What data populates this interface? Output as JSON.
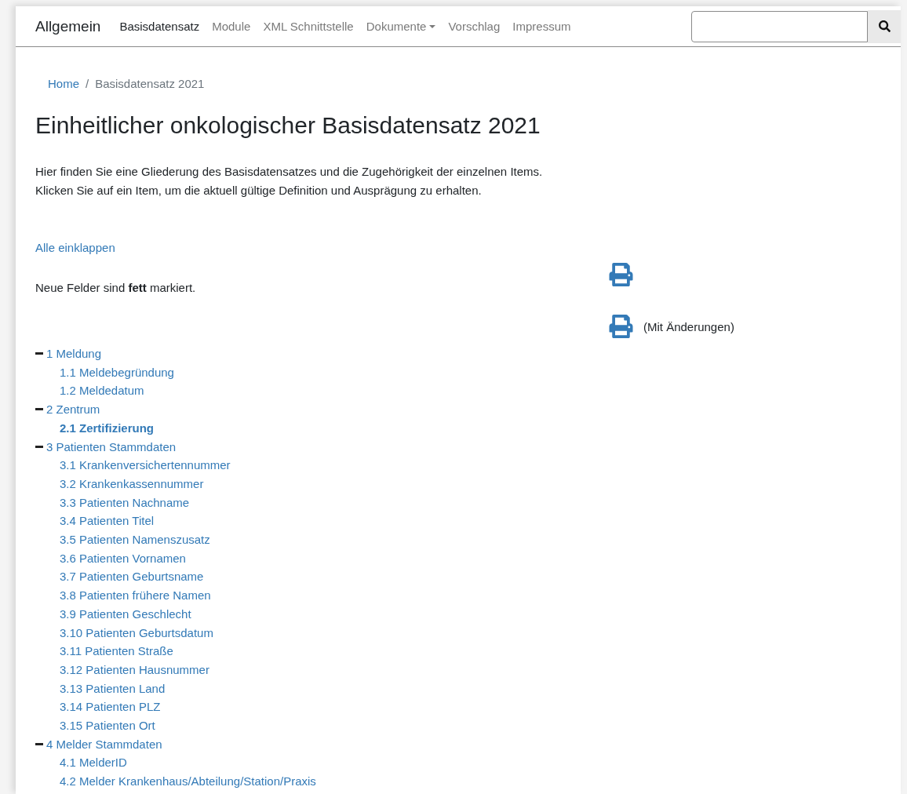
{
  "navbar": {
    "brand": "Allgemein",
    "items": [
      {
        "label": "Basisdatensatz",
        "selected": true,
        "dropdown": false
      },
      {
        "label": "Module",
        "selected": false,
        "dropdown": false
      },
      {
        "label": "XML Schnittstelle",
        "selected": false,
        "dropdown": false
      },
      {
        "label": "Dokumente",
        "selected": false,
        "dropdown": true
      },
      {
        "label": "Vorschlag",
        "selected": false,
        "dropdown": false
      },
      {
        "label": "Impressum",
        "selected": false,
        "dropdown": false
      }
    ]
  },
  "breadcrumb": {
    "separator": "/",
    "items": [
      {
        "label": "Home",
        "link": true
      },
      {
        "label": "Basisdatensatz 2021",
        "link": false
      }
    ]
  },
  "title": "Einheitlicher onkologischer Basisdatensatz 2021",
  "intro": [
    "Hier finden Sie eine Gliederung des Basisdatensatzes und die Zugehörigkeit der einzelnen Items.",
    "Klicken Sie auf ein Item, um die aktuell gültige Definition und Ausprägung zu erhalten."
  ],
  "collapse_all": "Alle einklappen",
  "legend": "Neue Felder sind **fett** markiert.",
  "print_links": [
    {
      "kind": "icon"
    },
    {
      "kind": "labeled",
      "label": "(Mit Änderungen)"
    }
  ],
  "tree": [
    {
      "label": "1 Meldung",
      "expanded": true,
      "children": [
        {
          "label": "1.1 Meldebegründung",
          "bold": false
        },
        {
          "label": "1.2 Meldedatum",
          "bold": false
        }
      ]
    },
    {
      "label": "2 Zentrum",
      "expanded": true,
      "children": [
        {
          "label": "2.1 Zertifizierung",
          "bold": true
        }
      ]
    },
    {
      "label": "3 Patienten Stammdaten",
      "expanded": true,
      "children": [
        {
          "label": "3.1 Krankenversichertennummer",
          "bold": false
        },
        {
          "label": "3.2 Krankenkassennummer",
          "bold": false
        },
        {
          "label": "3.3 Patienten Nachname",
          "bold": false
        },
        {
          "label": "3.4 Patienten Titel",
          "bold": false
        },
        {
          "label": "3.5 Patienten Namenszusatz",
          "bold": false
        },
        {
          "label": "3.6 Patienten Vornamen",
          "bold": false
        },
        {
          "label": "3.7 Patienten Geburtsname",
          "bold": false
        },
        {
          "label": "3.8 Patienten frühere Namen",
          "bold": false
        },
        {
          "label": "3.9 Patienten Geschlecht",
          "bold": false
        },
        {
          "label": "3.10 Patienten Geburtsdatum",
          "bold": false
        },
        {
          "label": "3.11 Patienten Straße",
          "bold": false
        },
        {
          "label": "3.12 Patienten Hausnummer",
          "bold": false
        },
        {
          "label": "3.13 Patienten Land",
          "bold": false
        },
        {
          "label": "3.14 Patienten PLZ",
          "bold": false
        },
        {
          "label": "3.15 Patienten Ort",
          "bold": false
        }
      ]
    },
    {
      "label": "4 Melder Stammdaten",
      "expanded": true,
      "children": [
        {
          "label": "4.1 MelderID",
          "bold": false
        },
        {
          "label": "4.2 Melder Krankenhaus/Abteilung/Station/Praxis",
          "bold": false
        }
      ]
    }
  ]
}
